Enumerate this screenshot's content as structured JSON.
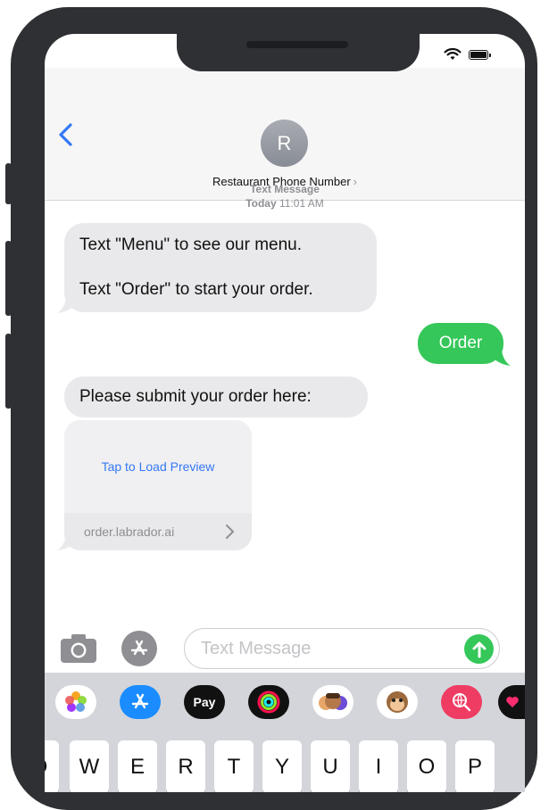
{
  "contact": {
    "initial": "R",
    "name": "Restaurant Phone Number",
    "chevron": "›"
  },
  "timestamp": {
    "service": "Text Message",
    "day": "Today",
    "time": "11:01 AM"
  },
  "messages": [
    {
      "direction": "incoming",
      "line1": "Text \"Menu\" to see our menu.",
      "line2": "Text \"Order\" to start your order."
    },
    {
      "direction": "outgoing",
      "text": "Order"
    },
    {
      "direction": "incoming",
      "text": "Please submit your order here:"
    }
  ],
  "link_preview": {
    "label": "Tap to Load Preview",
    "domain": "order.labrador.ai"
  },
  "input": {
    "placeholder": "Text Message"
  },
  "apps": [
    {
      "name": "photos-app-icon",
      "label": ""
    },
    {
      "name": "appstore-app-icon",
      "label": ""
    },
    {
      "name": "apple-pay-app-icon",
      "label": "Pay"
    },
    {
      "name": "fitness-app-icon",
      "label": ""
    },
    {
      "name": "memoji-app-icon",
      "label": ""
    },
    {
      "name": "animoji-app-icon",
      "label": ""
    },
    {
      "name": "image-search-app-icon",
      "label": ""
    },
    {
      "name": "digital-touch-app-icon",
      "label": ""
    }
  ],
  "keyboard": {
    "row1": [
      "Q",
      "W",
      "E",
      "R",
      "T",
      "Y",
      "U",
      "I",
      "O",
      "P"
    ]
  },
  "colors": {
    "incoming_bubble": "#e9e9eb",
    "outgoing_bubble": "#35c759",
    "link_blue": "#3478f6",
    "frame": "#2e3034"
  }
}
